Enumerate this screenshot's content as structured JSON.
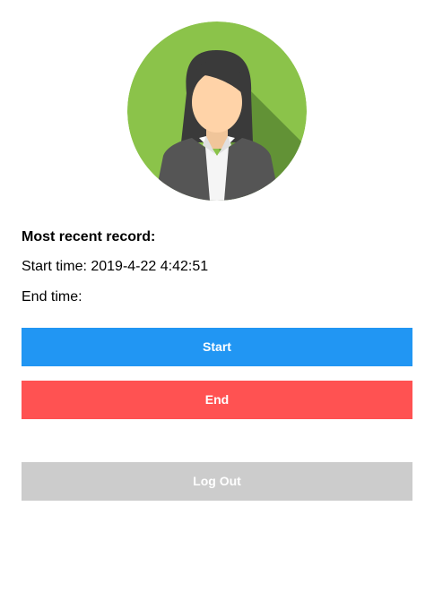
{
  "avatar": {
    "icon": "woman-user-avatar-icon",
    "background_color": "#8bc34a",
    "shadow_color": "#5b8a32"
  },
  "record": {
    "heading": "Most recent record:",
    "start_label": "Start time:",
    "start_value": "2019-4-22 4:42:51",
    "end_label": "End time:",
    "end_value": ""
  },
  "buttons": {
    "start_label": "Start",
    "start_color": "#2196f3",
    "end_label": "End",
    "end_color": "#ff5252",
    "logout_label": "Log Out",
    "logout_color": "#cccccc"
  }
}
